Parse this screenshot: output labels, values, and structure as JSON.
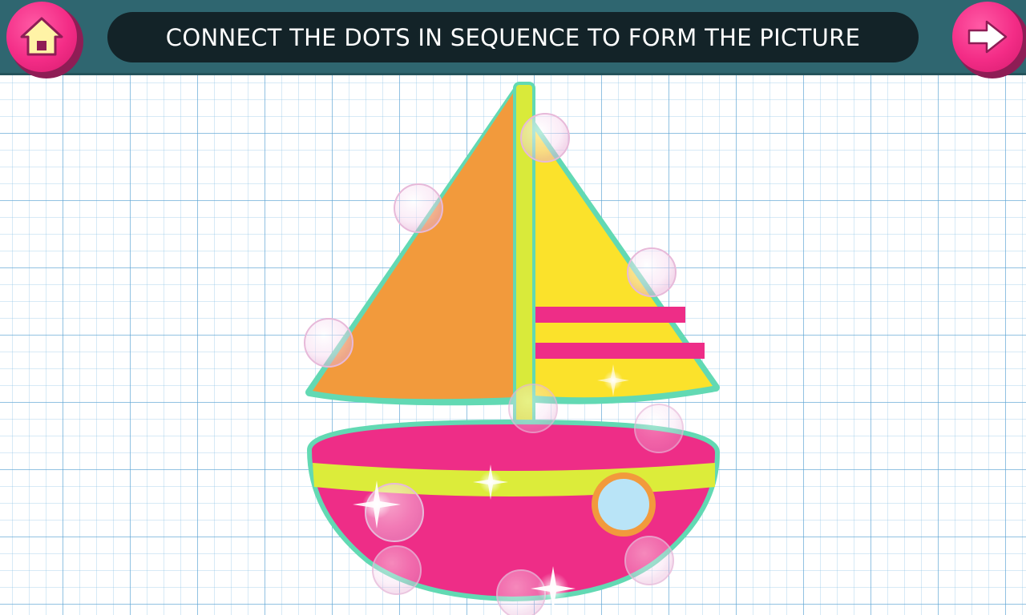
{
  "header": {
    "instruction": "CONNECT THE DOTS IN SEQUENCE TO FORM THE PICTURE"
  },
  "icons": {
    "home": "home-icon",
    "next": "arrow-right-icon"
  },
  "colors": {
    "topbar": "#2f6670",
    "pill": "#132328",
    "button": "#f32c86",
    "sail_left": "#f29a3c",
    "sail_right": "#fbe22b",
    "mast": "#d9ea3a",
    "hull": "#ee2d87",
    "hull_stripe": "#dcec3a",
    "sail_stripe": "#ee2d87",
    "porthole_glass": "#b9e4f7",
    "porthole_rim": "#f29a3c",
    "outline": "#62d9b3"
  }
}
